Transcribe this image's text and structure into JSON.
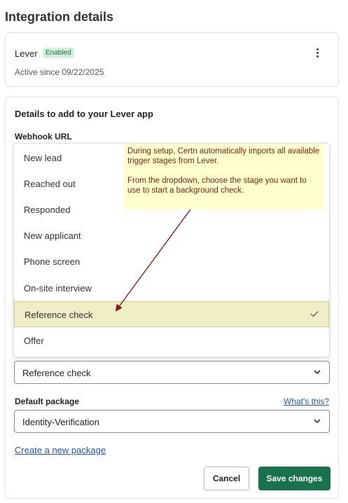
{
  "page_title": "Integration details",
  "integration": {
    "name": "Lever",
    "status": "Enabled",
    "active_since": "Active since 09/22/2025"
  },
  "details": {
    "section_title": "Details to add to your Lever app",
    "webhook_label": "Webhook URL"
  },
  "dropdown": {
    "options": [
      "New lead",
      "Reached out",
      "Responded",
      "New applicant",
      "Phone screen",
      "On-site interview",
      "Reference check",
      "Offer"
    ],
    "selected": "Reference check"
  },
  "stage_select": {
    "value": "Reference check"
  },
  "package": {
    "label": "Default package",
    "help_link": "What's this?",
    "value": "Identity-Verification"
  },
  "create_link": "Create a new package",
  "buttons": {
    "cancel": "Cancel",
    "save": "Save changes"
  },
  "annotation": {
    "p1": "During setup, Certn automatically imports all available trigger stages from Lever.",
    "p2": "From the dropdown, choose the stage you want to use to start a background check."
  },
  "colors": {
    "primary": "#17724d",
    "link": "#1f55b5",
    "badge_bg": "#d5efdd",
    "note_bg": "#ffffcf",
    "note_text": "#7a1f14",
    "arrow": "#8b1a1a"
  }
}
